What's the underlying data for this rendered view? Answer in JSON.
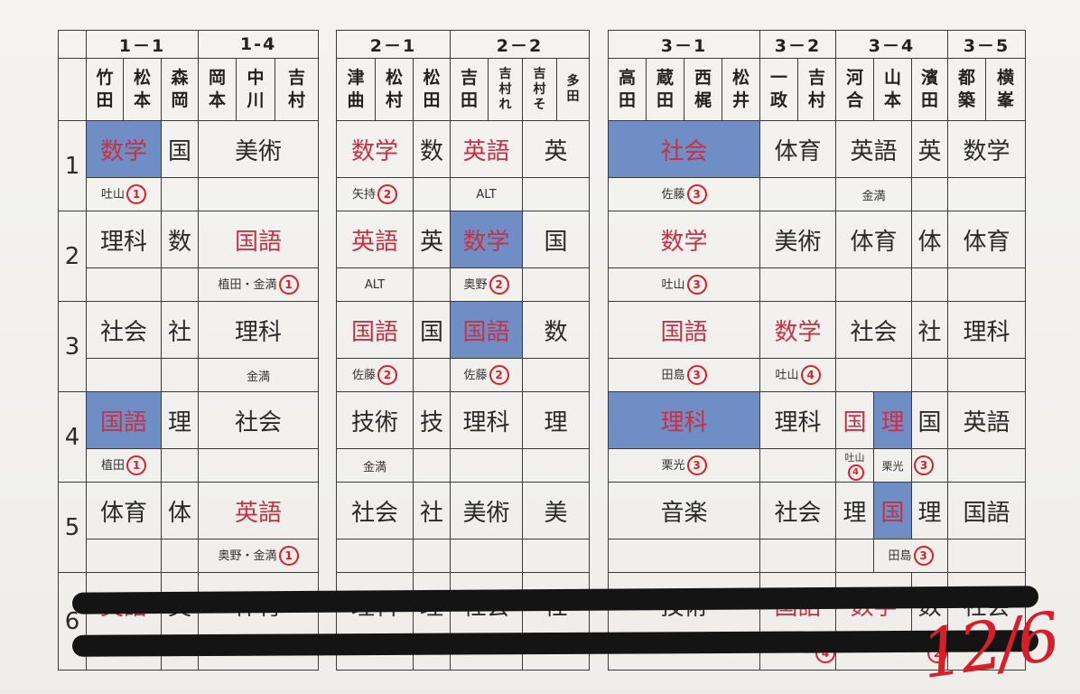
{
  "periods": [
    "1",
    "2",
    "3",
    "4",
    "5",
    "6"
  ],
  "left": {
    "groups": [
      "1－1",
      "1-4"
    ],
    "names": [
      [
        "竹",
        "田"
      ],
      [
        "松",
        "本"
      ],
      [
        "森",
        "岡"
      ],
      [
        "岡",
        "本"
      ],
      [
        "中",
        "川"
      ],
      [
        "吉",
        "村"
      ]
    ],
    "p1": {
      "s1": "数学",
      "s2": "国",
      "s3": "美術",
      "note": "吐山",
      "num": "1"
    },
    "p2": {
      "s1": "理科",
      "s2": "数",
      "s3": "国語",
      "note": "植田・金満",
      "num": "1"
    },
    "p3": {
      "s1": "社会",
      "s2": "社",
      "s3": "理科",
      "note": "金満"
    },
    "p4": {
      "s1": "国語",
      "s2": "理",
      "s3": "社会",
      "note": "植田",
      "num": "1"
    },
    "p5": {
      "s1": "体育",
      "s2": "体",
      "s3": "英語",
      "note": "奥野・金満",
      "num": "1"
    },
    "p6": {
      "s1": "英語",
      "s2": "英",
      "s3": "体育"
    }
  },
  "mid": {
    "groups": [
      "2－1",
      "2－2"
    ],
    "names": [
      [
        "津",
        "曲"
      ],
      [
        "松",
        "村"
      ],
      [
        "松",
        "田"
      ],
      [
        "吉",
        "田"
      ],
      [
        "吉",
        "村",
        "れ"
      ],
      [
        "吉",
        "村",
        "そ"
      ],
      [
        "多",
        "田"
      ]
    ],
    "p1": {
      "s1": "数学",
      "s2": "数",
      "s3": "英語",
      "s4": "英",
      "n1": "矢持",
      "num1": "2",
      "n2": "ALT"
    },
    "p2": {
      "s1": "英語",
      "s2": "英",
      "s3": "数学",
      "s4": "国",
      "n1": "ALT",
      "n2": "奥野",
      "num2": "2"
    },
    "p3": {
      "s1": "国語",
      "s2": "国",
      "s3": "国語",
      "s4": "数",
      "n1": "佐藤",
      "num1": "2",
      "n2": "佐藤",
      "num2": "2"
    },
    "p4": {
      "s1": "技術",
      "s2": "技",
      "s3": "理科",
      "s4": "理",
      "n1": "金満"
    },
    "p5": {
      "s1": "社会",
      "s2": "社",
      "s3": "美術",
      "s4": "美"
    },
    "p6": {
      "s1": "理科",
      "s2": "理",
      "s3": "社会",
      "s4": "社"
    }
  },
  "right": {
    "groups": [
      "3－1",
      "3－2",
      "3－4",
      "3－5"
    ],
    "names": [
      [
        "高",
        "田"
      ],
      [
        "蔵",
        "田"
      ],
      [
        "西",
        "梶"
      ],
      [
        "松",
        "井"
      ],
      [
        "一",
        "政"
      ],
      [
        "吉",
        "村"
      ],
      [
        "河",
        "合"
      ],
      [
        "山",
        "本"
      ],
      [
        "濱",
        "田"
      ],
      [
        "都",
        "築"
      ],
      [
        "横",
        "峯"
      ]
    ],
    "p1": {
      "s1": "社会",
      "s2": "体育",
      "s3": "英語",
      "s4": "英",
      "s5": "数学",
      "n1": "佐藤",
      "num1": "3",
      "n3": "金満"
    },
    "p2": {
      "s1": "数学",
      "s2": "美術",
      "s3": "体育",
      "s4": "体",
      "s5": "体育",
      "n1": "吐山",
      "num1": "3"
    },
    "p3": {
      "s1": "国語",
      "s2": "数学",
      "s3": "社会",
      "s4": "社",
      "s5": "理科",
      "n1": "田島",
      "num1": "3",
      "n2": "吐山",
      "num2": "4"
    },
    "p4": {
      "s1": "理科",
      "s2": "理科",
      "s3a": "国",
      "s3b": "理",
      "s4": "国",
      "s5": "英語",
      "n1": "栗光",
      "num1": "3",
      "n3a": "吐山",
      "num3a": "4",
      "n3b": "栗光",
      "num3b": "3"
    },
    "p5": {
      "s1": "音楽",
      "s2": "社会",
      "s3a": "理",
      "s3b": "国",
      "s4": "理",
      "s5": "国語",
      "n3b": "田島",
      "num3b": "3"
    },
    "p6": {
      "s1": "技術",
      "s2": "国語",
      "s3": "数学",
      "s4": "数",
      "s5": "社会",
      "num2": "4",
      "num3": "2"
    }
  },
  "date": "12/6"
}
